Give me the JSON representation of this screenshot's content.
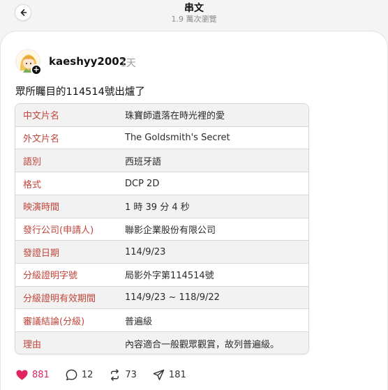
{
  "header": {
    "title": "串文",
    "subtitle": "1.9 萬次瀏覽"
  },
  "post": {
    "username": "kaeshyy2002",
    "time_ago": "1天",
    "text": "眾所矚目的114514號出爐了",
    "follow_symbol": "+"
  },
  "info_table": [
    {
      "key": "中文片名",
      "value": "珠寶師遺落在時光裡的愛"
    },
    {
      "key": "外文片名",
      "value": "The Goldsmith's Secret"
    },
    {
      "key": "語別",
      "value": "西班牙語"
    },
    {
      "key": "格式",
      "value": "DCP 2D"
    },
    {
      "key": "映演時間",
      "value": "1 時 39 分 4 秒"
    },
    {
      "key": "發行公司(申請人)",
      "value": "聯影企業股份有限公司"
    },
    {
      "key": "發證日期",
      "value": "114/9/23"
    },
    {
      "key": "分級證明字號",
      "value": "局影外字第114514號"
    },
    {
      "key": "分級證明有效期間",
      "value": "114/9/23 ~ 118/9/22"
    },
    {
      "key": "審議結論(分級)",
      "value": "普遍級"
    },
    {
      "key": "理由",
      "value": "內容適合一般觀眾觀賞，故列普遍級。"
    }
  ],
  "actions": {
    "likes": "881",
    "comments": "12",
    "reposts": "73",
    "shares": "181"
  },
  "colors": {
    "accent_like": "#e0245e",
    "table_key": "#c0453a"
  }
}
